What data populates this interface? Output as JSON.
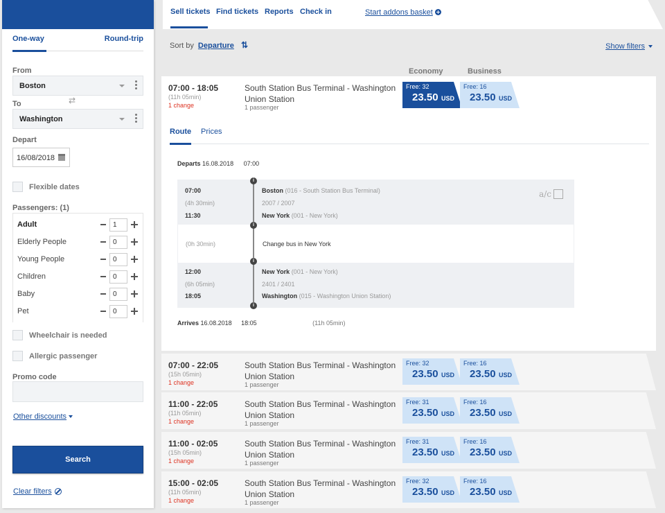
{
  "sidebar": {
    "trip_tabs": {
      "one_way": "One-way",
      "round_trip": "Round-trip"
    },
    "from_label": "From",
    "from_value": "Boston",
    "to_label": "To",
    "to_value": "Washington",
    "depart_label": "Depart",
    "depart_value": "16/08/2018",
    "flexible_dates": "Flexible dates",
    "passengers_label": "Passengers: (1)",
    "passengers": [
      {
        "name": "Adult",
        "count": "1"
      },
      {
        "name": "Elderly People",
        "count": "0"
      },
      {
        "name": "Young People",
        "count": "0"
      },
      {
        "name": "Children",
        "count": "0"
      },
      {
        "name": "Baby",
        "count": "0"
      },
      {
        "name": "Pet",
        "count": "0"
      }
    ],
    "wheelchair": "Wheelchair is needed",
    "allergic": "Allergic passenger",
    "promo_label": "Promo code",
    "promo_value": "",
    "other_discounts": "Other discounts",
    "search": "Search",
    "clear_filters": "Clear filters"
  },
  "nav": {
    "tabs": [
      "Sell tickets",
      "Find tickets",
      "Reports",
      "Check in"
    ],
    "basket": "Start addons basket"
  },
  "sort": {
    "label": "Sort by",
    "value": "Departure",
    "show_filters": "Show filters"
  },
  "classes": {
    "economy": "Economy",
    "business": "Business"
  },
  "trips": [
    {
      "time": "07:00 - 18:05",
      "duration": "(11h 05min)",
      "changes": "1 change",
      "route": "South Station Bus Terminal - Washington Union Station",
      "passengers": "1 passenger",
      "eco_free": "Free: 32",
      "eco_price": "23.50",
      "bus_free": "Free: 16",
      "bus_price": "23.50",
      "currency": "USD"
    },
    {
      "time": "07:00 - 22:05",
      "duration": "(15h 05min)",
      "changes": "1 change",
      "route": "South Station Bus Terminal - Washington Union Station",
      "passengers": "1 passenger",
      "eco_free": "Free: 32",
      "eco_price": "23.50",
      "bus_free": "Free: 16",
      "bus_price": "23.50",
      "currency": "USD"
    },
    {
      "time": "11:00 - 22:05",
      "duration": "(11h 05min)",
      "changes": "1 change",
      "route": "South Station Bus Terminal - Washington Union Station",
      "passengers": "1 passenger",
      "eco_free": "Free: 31",
      "eco_price": "23.50",
      "bus_free": "Free: 16",
      "bus_price": "23.50",
      "currency": "USD"
    },
    {
      "time": "11:00 - 02:05",
      "duration": "(15h 05min)",
      "changes": "1 change",
      "route": "South Station Bus Terminal - Washington Union Station",
      "passengers": "1 passenger",
      "eco_free": "Free: 31",
      "eco_price": "23.50",
      "bus_free": "Free: 16",
      "bus_price": "23.50",
      "currency": "USD"
    },
    {
      "time": "15:00 - 02:05",
      "duration": "(11h 05min)",
      "changes": "1 change",
      "route": "South Station Bus Terminal - Washington Union Station",
      "passengers": "1 passenger",
      "eco_free": "Free: 32",
      "eco_price": "23.50",
      "bus_free": "Free: 16",
      "bus_price": "23.50",
      "currency": "USD"
    }
  ],
  "details": {
    "tabs": [
      "Route",
      "Prices"
    ],
    "departs_label": "Departs",
    "departs_date": "16.08.2018",
    "departs_time": "07:00",
    "seg1": {
      "dep": "07:00",
      "dur": "(4h 30min)",
      "arr": "11:30",
      "from": "Boston",
      "from_stop": " (016 - South Station Bus Terminal)",
      "trip": "2007 / 2007",
      "to": "New York",
      "to_stop": " (001 - New York)"
    },
    "change_dur": "(0h 30min)",
    "change_text": "Change bus in New York",
    "seg2": {
      "dep": "12:00",
      "dur": "(6h 05min)",
      "arr": "18:05",
      "from": "New York",
      "from_stop": " (001 - New York)",
      "trip": "2401 / 2401",
      "to": "Washington",
      "to_stop": " (015 - Washington Union Station)"
    },
    "amenity": "a/c",
    "arrives_label": "Arrives",
    "arrives_date": "16.08.2018",
    "arrives_time": "18:05",
    "arrives_total": "(11h 05min)"
  }
}
